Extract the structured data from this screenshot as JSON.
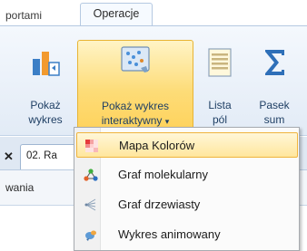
{
  "tabs": {
    "raporty": "portami",
    "operacje": "Operacje"
  },
  "ribbon": {
    "pokaz_wykres": {
      "line1": "Pokaż",
      "line2": "wykres",
      "icon": "bar-chart-icon"
    },
    "pokaz_interaktywny": {
      "line1": "Pokaż wykres",
      "line2": "interaktywny",
      "arrow": "▾",
      "icon": "interactive-chart-icon"
    },
    "lista_pol": {
      "line1": "Lista",
      "line2": "pól",
      "icon": "field-list-icon"
    },
    "pasek_sum": {
      "line1": "Pasek",
      "line2": "sum",
      "icon": "sigma-icon"
    }
  },
  "document": {
    "tab_close": "✕",
    "tab_label": "02. Ra",
    "row_text": "wania"
  },
  "menu": {
    "items": [
      {
        "label": "Mapa Kolorów",
        "icon": "color-map-icon",
        "selected": true
      },
      {
        "label": "Graf molekularny",
        "icon": "molecular-graph-icon",
        "selected": false
      },
      {
        "label": "Graf drzewiasty",
        "icon": "tree-graph-icon",
        "selected": false
      },
      {
        "label": "Wykres animowany",
        "icon": "animated-chart-icon",
        "selected": false
      }
    ]
  },
  "colors": {
    "highlight_border": "#f0b43c",
    "highlight_fill": "#ffe69d",
    "ribbon_text": "#1f3f64"
  }
}
